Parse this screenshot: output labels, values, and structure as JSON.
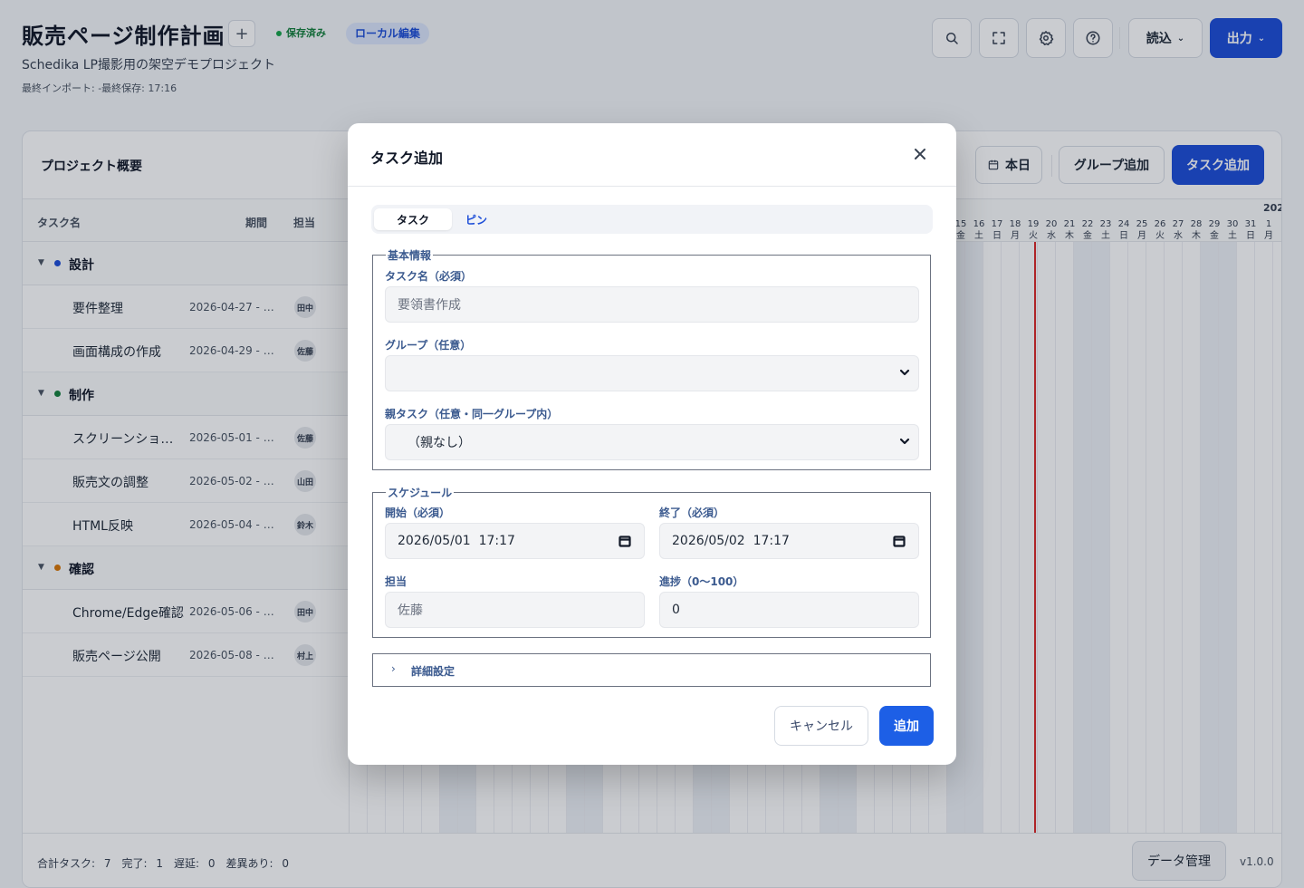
{
  "header": {
    "title": "販売ページ制作計画",
    "add_label": "+",
    "saved_badge": "保存済み",
    "local_badge": "ローカル編集",
    "subtitle": "Schedika LP撮影用の架空デモプロジェクト",
    "meta": "最終インポート: -最終保存: 17:16",
    "read_label": "読込",
    "output_label": "出力",
    "icons": [
      "search-icon",
      "fullscreen-icon",
      "gear-icon",
      "help-icon"
    ]
  },
  "panel": {
    "title": "プロジェクト概要",
    "today_label": "本日",
    "add_group_label": "グループ追加",
    "add_task_label": "タスク追加",
    "columns": {
      "name": "タスク名",
      "period": "期間",
      "assignee": "担当"
    },
    "groups": [
      {
        "name": "設計",
        "color": "#1d4ed8",
        "tasks": [
          {
            "name": "要件整理",
            "period": "2026-04-27 - 20...",
            "assignee": "田中"
          },
          {
            "name": "画面構成の作成",
            "period": "2026-04-29 - 20...",
            "assignee": "佐藤"
          }
        ]
      },
      {
        "name": "制作",
        "color": "#15803d",
        "tasks": [
          {
            "name": "スクリーンショット撮影",
            "period": "2026-05-01 - 20...",
            "assignee": "佐藤"
          },
          {
            "name": "販売文の調整",
            "period": "2026-05-02 - 20...",
            "assignee": "山田"
          },
          {
            "name": "HTML反映",
            "period": "2026-05-04 - 20...",
            "assignee": "鈴木"
          }
        ]
      },
      {
        "name": "確認",
        "color": "#d97706",
        "tasks": [
          {
            "name": "Chrome/Edge確認",
            "period": "2026-05-06 - 20...",
            "assignee": "田中"
          },
          {
            "name": "販売ページ公開",
            "period": "2026-05-08 - 20...",
            "assignee": "村上"
          }
        ]
      }
    ],
    "timeline": {
      "year_label": "202",
      "days": [
        {
          "d": "15",
          "w": "金"
        },
        {
          "d": "16",
          "w": "土"
        },
        {
          "d": "17",
          "w": "日"
        },
        {
          "d": "18",
          "w": "月"
        },
        {
          "d": "19",
          "w": "火"
        },
        {
          "d": "20",
          "w": "水"
        },
        {
          "d": "21",
          "w": "木"
        },
        {
          "d": "22",
          "w": "金"
        },
        {
          "d": "23",
          "w": "土"
        },
        {
          "d": "24",
          "w": "日"
        },
        {
          "d": "25",
          "w": "月"
        },
        {
          "d": "26",
          "w": "火"
        },
        {
          "d": "27",
          "w": "水"
        },
        {
          "d": "28",
          "w": "木"
        },
        {
          "d": "29",
          "w": "金"
        },
        {
          "d": "30",
          "w": "土"
        },
        {
          "d": "31",
          "w": "日"
        },
        {
          "d": "1",
          "w": "月"
        }
      ]
    },
    "footer": {
      "stats": "合計タスク: 7　完了: 1　遅延: 0　差異あり: 0",
      "data_label": "データ管理",
      "version": "v1.0.0"
    }
  },
  "modal": {
    "title": "タスク追加",
    "tabs": [
      "タスク",
      "ピン"
    ],
    "basic": {
      "legend": "基本情報",
      "name_label": "タスク名（必須）",
      "name_placeholder": "要領書作成",
      "group_label": "グループ（任意）",
      "group_value": "",
      "parent_label": "親タスク（任意・同一グループ内）",
      "parent_value": "（親なし）"
    },
    "schedule": {
      "legend": "スケジュール",
      "start_label": "開始（必須）",
      "start_value": "2026/05/01  17:17",
      "end_label": "終了（必須）",
      "end_value": "2026/05/02  17:17",
      "assignee_label": "担当",
      "assignee_placeholder": "佐藤",
      "progress_label": "進捗（0〜100）",
      "progress_value": "0"
    },
    "details_label": "詳細設定",
    "cancel_label": "キャンセル",
    "add_label": "追加"
  }
}
